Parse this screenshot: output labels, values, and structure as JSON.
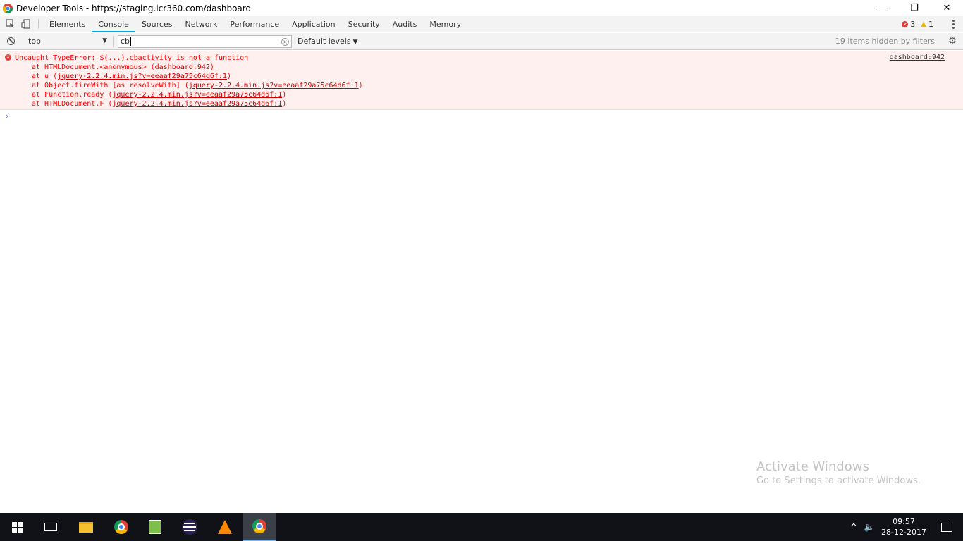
{
  "window": {
    "title": "Developer Tools - https://staging.icr360.com/dashboard",
    "minimize": "—",
    "restore": "❐",
    "close": "✕"
  },
  "tabs": [
    {
      "label": "Elements"
    },
    {
      "label": "Console",
      "active": true
    },
    {
      "label": "Sources"
    },
    {
      "label": "Network"
    },
    {
      "label": "Performance"
    },
    {
      "label": "Application"
    },
    {
      "label": "Security"
    },
    {
      "label": "Audits"
    },
    {
      "label": "Memory"
    }
  ],
  "counters": {
    "errors": "3",
    "warnings": "1"
  },
  "console_toolbar": {
    "context": "top",
    "filter_value": "cb",
    "levels": "Default levels",
    "hidden": "19 items hidden by filters"
  },
  "error": {
    "message": "Uncaught TypeError: $(...).cbactivity is not a function",
    "source": "dashboard:942",
    "stack": [
      {
        "prefix": "at HTMLDocument.<anonymous> (",
        "link": "dashboard:942",
        "suffix": ")"
      },
      {
        "prefix": "at u (",
        "link": "jquery-2.2.4.min.js?v=eeaaf29a75c64d6f:1",
        "suffix": ")"
      },
      {
        "prefix": "at Object.fireWith [as resolveWith] (",
        "link": "jquery-2.2.4.min.js?v=eeaaf29a75c64d6f:1",
        "suffix": ")"
      },
      {
        "prefix": "at Function.ready (",
        "link": "jquery-2.2.4.min.js?v=eeaaf29a75c64d6f:1",
        "suffix": ")"
      },
      {
        "prefix": "at HTMLDocument.F (",
        "link": "jquery-2.2.4.min.js?v=eeaaf29a75c64d6f:1",
        "suffix": ")"
      }
    ]
  },
  "prompt_symbol": "›",
  "watermark": {
    "line1": "Activate Windows",
    "line2": "Go to Settings to activate Windows."
  },
  "taskbar": {
    "time": "09:57",
    "date": "28-12-2017"
  },
  "colors": {
    "error_text": "#ff0000",
    "error_bg": "#fff0f0",
    "active_tab_accent": "#03a9f4"
  }
}
